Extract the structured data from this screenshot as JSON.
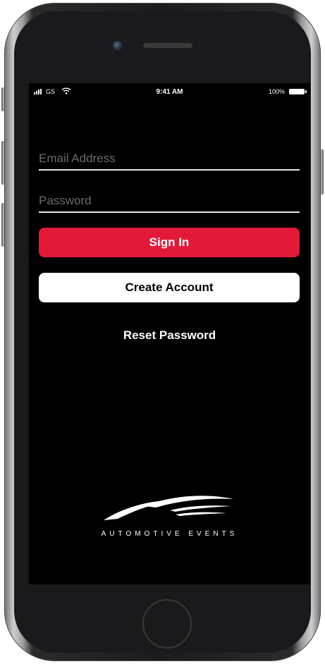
{
  "status_bar": {
    "carrier": "GS",
    "time": "9:41 AM",
    "battery_percent": "100%"
  },
  "login": {
    "email_placeholder": "Email Address",
    "password_placeholder": "Password",
    "sign_in_label": "Sign In",
    "create_account_label": "Create Account",
    "reset_password_label": "Reset Password"
  },
  "brand": {
    "name": "AUTOMOTIVE EVENTS"
  },
  "colors": {
    "screen_background": "#000000",
    "sign_in_button": "#e3193a",
    "create_account_button": "#ffffff",
    "input_underline": "#e6e6e6",
    "placeholder_text": "#6b6b6b"
  },
  "icons": [
    "signal-icon",
    "wifi-icon",
    "battery-icon",
    "automotive-events-logo"
  ]
}
